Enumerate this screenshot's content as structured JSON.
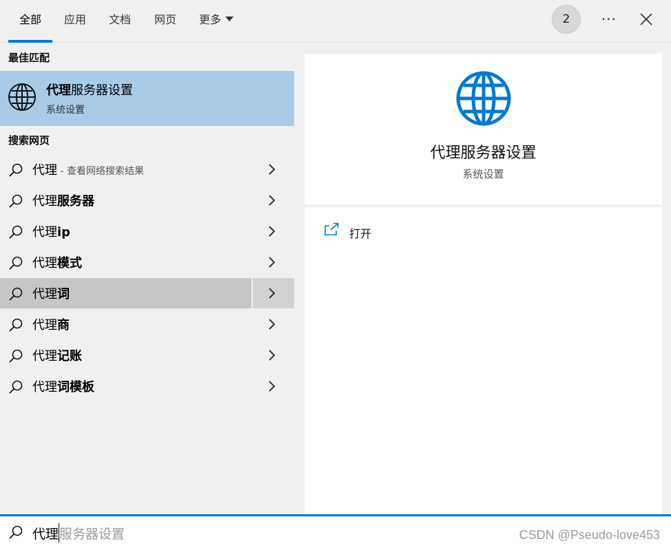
{
  "tabs": {
    "all": "全部",
    "apps": "应用",
    "docs": "文档",
    "web": "网页",
    "more": "更多"
  },
  "header": {
    "badge_count": "2",
    "more_label": "···"
  },
  "best_match": {
    "section_title": "最佳匹配",
    "title_bold": "代理",
    "title_rest": "服务器设置",
    "subtitle": "系统设置",
    "icon": "globe-icon"
  },
  "web_search": {
    "section_title": "搜索网页",
    "items": [
      {
        "prefix": "代理",
        "bold": "",
        "hint": " - 查看网络搜索结果"
      },
      {
        "prefix": "代理",
        "bold": "服务器",
        "hint": ""
      },
      {
        "prefix": "代理",
        "bold": "ip",
        "hint": ""
      },
      {
        "prefix": "代理",
        "bold": "模式",
        "hint": ""
      },
      {
        "prefix": "代理",
        "bold": "词",
        "hint": ""
      },
      {
        "prefix": "代理",
        "bold": "商",
        "hint": ""
      },
      {
        "prefix": "代理",
        "bold": "记账",
        "hint": ""
      },
      {
        "prefix": "代理",
        "bold": "词模板",
        "hint": ""
      }
    ]
  },
  "preview": {
    "title": "代理服务器设置",
    "subtitle": "系统设置",
    "actions": [
      {
        "label": "打开",
        "icon": "open-external-icon"
      }
    ]
  },
  "search": {
    "typed": "代理",
    "suggestion": "服务器设置"
  },
  "watermark": "CSDN @Pseudo-love453",
  "colors": {
    "accent": "#0078d4",
    "selected_bg": "#a9cbe8",
    "hover_bg": "#c6c6c6"
  }
}
